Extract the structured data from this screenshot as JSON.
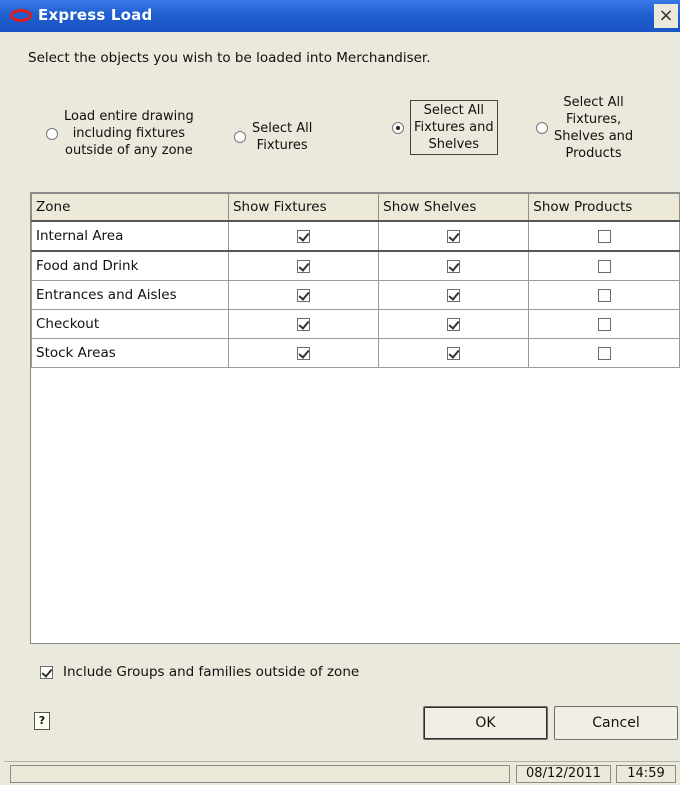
{
  "window": {
    "title": "Express Load",
    "close_glyph": "×"
  },
  "instruction": "Select the objects you wish to be loaded into Merchandiser.",
  "options": [
    {
      "lines": [
        "Load entire drawing",
        "including fixtures",
        "outside of any zone"
      ],
      "checked": false
    },
    {
      "lines": [
        "Select All",
        "Fixtures"
      ],
      "checked": false
    },
    {
      "lines": [
        "Select All",
        "Fixtures and",
        "Shelves"
      ],
      "checked": true
    },
    {
      "lines": [
        "Select All",
        "Fixtures,",
        "Shelves and",
        "Products"
      ],
      "checked": false
    }
  ],
  "grid": {
    "headers": [
      "Zone",
      "Show Fixtures",
      "Show Shelves",
      "Show Products"
    ],
    "rows": [
      {
        "zone": "Internal Area",
        "fixtures": true,
        "shelves": true,
        "products": false
      },
      {
        "zone": "Food and Drink",
        "fixtures": true,
        "shelves": true,
        "products": false
      },
      {
        "zone": "Entrances and Aisles",
        "fixtures": true,
        "shelves": true,
        "products": false
      },
      {
        "zone": "Checkout",
        "fixtures": true,
        "shelves": true,
        "products": false
      },
      {
        "zone": "Stock Areas",
        "fixtures": true,
        "shelves": true,
        "products": false
      }
    ]
  },
  "include_groups": {
    "label": "Include Groups and families outside of zone",
    "checked": true
  },
  "buttons": {
    "help_glyph": "?",
    "ok": "OK",
    "cancel": "Cancel"
  },
  "status": {
    "left": "",
    "date": "08/12/2011",
    "time": "14:59"
  },
  "colors": {
    "titlebar": "#1f5fcf",
    "logo": "#e21b1b",
    "dialog_bg": "#ece9d8"
  },
  "icons": [
    "oracle-logo-icon",
    "close-icon",
    "help-icon",
    "checkbox-icon",
    "radio-icon"
  ]
}
